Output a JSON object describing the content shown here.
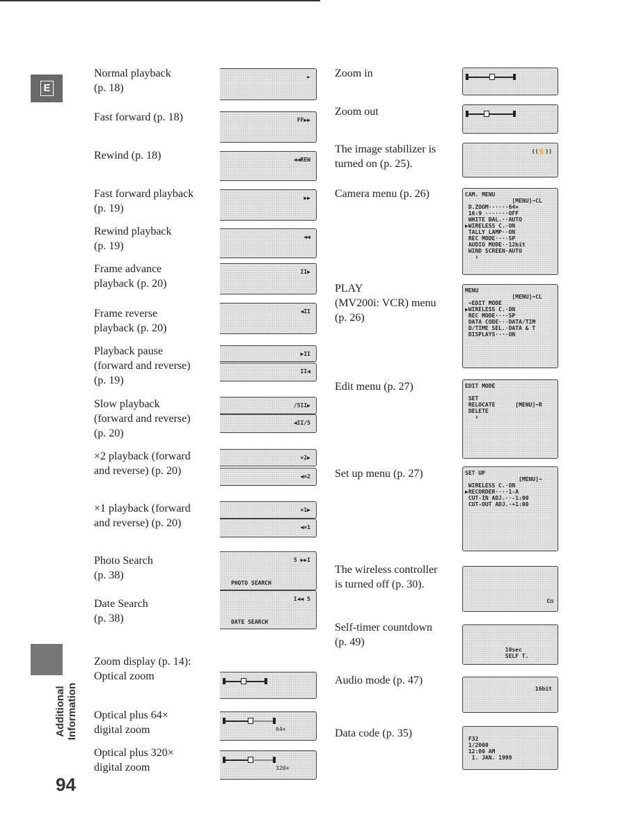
{
  "page_number": "94",
  "sidebar": {
    "section_letter": "E",
    "chapter_title": "Additional\nInformation"
  },
  "left_items": [
    {
      "label": "Normal playback\n(p. 18)",
      "screens": [
        {
          "text": "►"
        }
      ]
    },
    {
      "label": "Fast forward (p. 18)",
      "screens": [
        {
          "text": "FF▶▶"
        }
      ]
    },
    {
      "label": "Rewind (p. 18)",
      "screens": [
        {
          "text": "◀◀REW"
        }
      ]
    },
    {
      "label": "Fast forward playback\n(p. 19)",
      "screens": [
        {
          "text": "▶▶"
        }
      ]
    },
    {
      "label": "Rewind playback\n(p. 19)",
      "screens": [
        {
          "text": "◀◀"
        }
      ]
    },
    {
      "label": "Frame advance\nplayback (p. 20)",
      "screens": [
        {
          "text": "II▶"
        }
      ]
    },
    {
      "label": "Frame reverse\nplayback (p. 20)",
      "screens": [
        {
          "text": "◀II"
        }
      ]
    },
    {
      "label": "Playback pause\n(forward and reverse)\n(p. 19)",
      "screens": [
        {
          "text": "▶II"
        },
        {
          "text": "II◀"
        }
      ]
    },
    {
      "label": "Slow playback\n(forward and reverse)\n(p. 20)",
      "screens": [
        {
          "text": "/5II▶"
        },
        {
          "text": "◀II/5"
        }
      ]
    },
    {
      "label": "×2 playback (forward\nand reverse) (p. 20)",
      "screens": [
        {
          "text": "×2▶"
        },
        {
          "text": "◀×2"
        }
      ]
    },
    {
      "label": "×1 playback (forward\nand reverse) (p. 20)",
      "screens": [
        {
          "text": "×1▶"
        },
        {
          "text": "◀×1"
        }
      ]
    },
    {
      "label": "Photo Search\n(p. 38)",
      "screens": [
        {
          "text": "5 ▶▶I",
          "bottom": "PHOTO SEARCH"
        }
      ]
    },
    {
      "label": "Date Search\n(p. 38)",
      "screens": [
        {
          "text": "I◀◀ 5",
          "bottom": "DATE SEARCH"
        }
      ]
    },
    {
      "label": "Zoom display (p. 14):\nOptical zoom",
      "screens": [
        {
          "zoom": "optical"
        }
      ]
    },
    {
      "label": "Optical plus 64×\ndigital zoom",
      "screens": [
        {
          "zoom": "digital",
          "bottom": "64×"
        }
      ]
    },
    {
      "label": "Optical plus 320×\ndigital zoom",
      "screens": [
        {
          "zoom": "digital",
          "bottom": "320×"
        }
      ]
    }
  ],
  "right_items": [
    {
      "label": "Zoom in",
      "screens": [
        {
          "zoom": "in"
        }
      ]
    },
    {
      "label": "Zoom out",
      "screens": [
        {
          "zoom": "out"
        }
      ]
    },
    {
      "label": "The image stabilizer is\nturned on (p. 25).",
      "screens": [
        {
          "text": "((✋))"
        }
      ]
    },
    {
      "label": "Camera menu (p. 26)",
      "screens": [
        {
          "lines": "CAM. MENU\n              [MENU]➡CL\n D.ZOOM······64×\n 16:9 ·······OFF\n WHITE BAL.··AUTO\n▶WIRELESS C.·ON\n TALLY LAMP··ON\n REC MODE····SP\n AUDIO MODE··12bit\n WIND SCREEN·AUTO\n   ⬇"
        }
      ]
    },
    {
      "label": "PLAY\n(MV200i: VCR) menu\n(p. 26)",
      "screens": [
        {
          "lines": "MENU\n              [MENU]➡CL\n ➡EDIT MODE\n▶WIRELESS C.·ON\n REC MODE····SP\n DATA CODE···DATA/TIM\n D/TIME SEL.·DATA & T\n DISPLAYS····ON"
        }
      ]
    },
    {
      "label": "Edit menu (p. 27)",
      "screens": [
        {
          "lines": "EDIT MODE\n\n SET\n RELOCATE      [MENU]➡R\n DELETE\n   ⬇"
        }
      ]
    },
    {
      "label": "Set up menu (p. 27)",
      "screens": [
        {
          "lines": "SET UP\n                [MENU]➡\n WIRELESS C.·ON\n▶RECORDER····1-A\n CUT-IN ADJ.··-1:00\n CUT-OUT ADJ.·+1:00"
        }
      ]
    },
    {
      "label": "The wireless controller\nis turned off (p. 30).",
      "screens": [
        {
          "text": "C⊟",
          "valign": "bottom"
        }
      ]
    },
    {
      "label": "Self-timer countdown\n(p. 49)",
      "screens": [
        {
          "lines": "\n\n\n            10sec\n            SELF T."
        }
      ]
    },
    {
      "label": "Audio mode (p. 47)",
      "screens": [
        {
          "text": "16bit"
        }
      ]
    },
    {
      "label": "Data code (p. 35)",
      "screens": [
        {
          "lines": "\n F32\n 1/2000\n 12:00 AM\n  1. JAN. 1999"
        }
      ]
    }
  ]
}
